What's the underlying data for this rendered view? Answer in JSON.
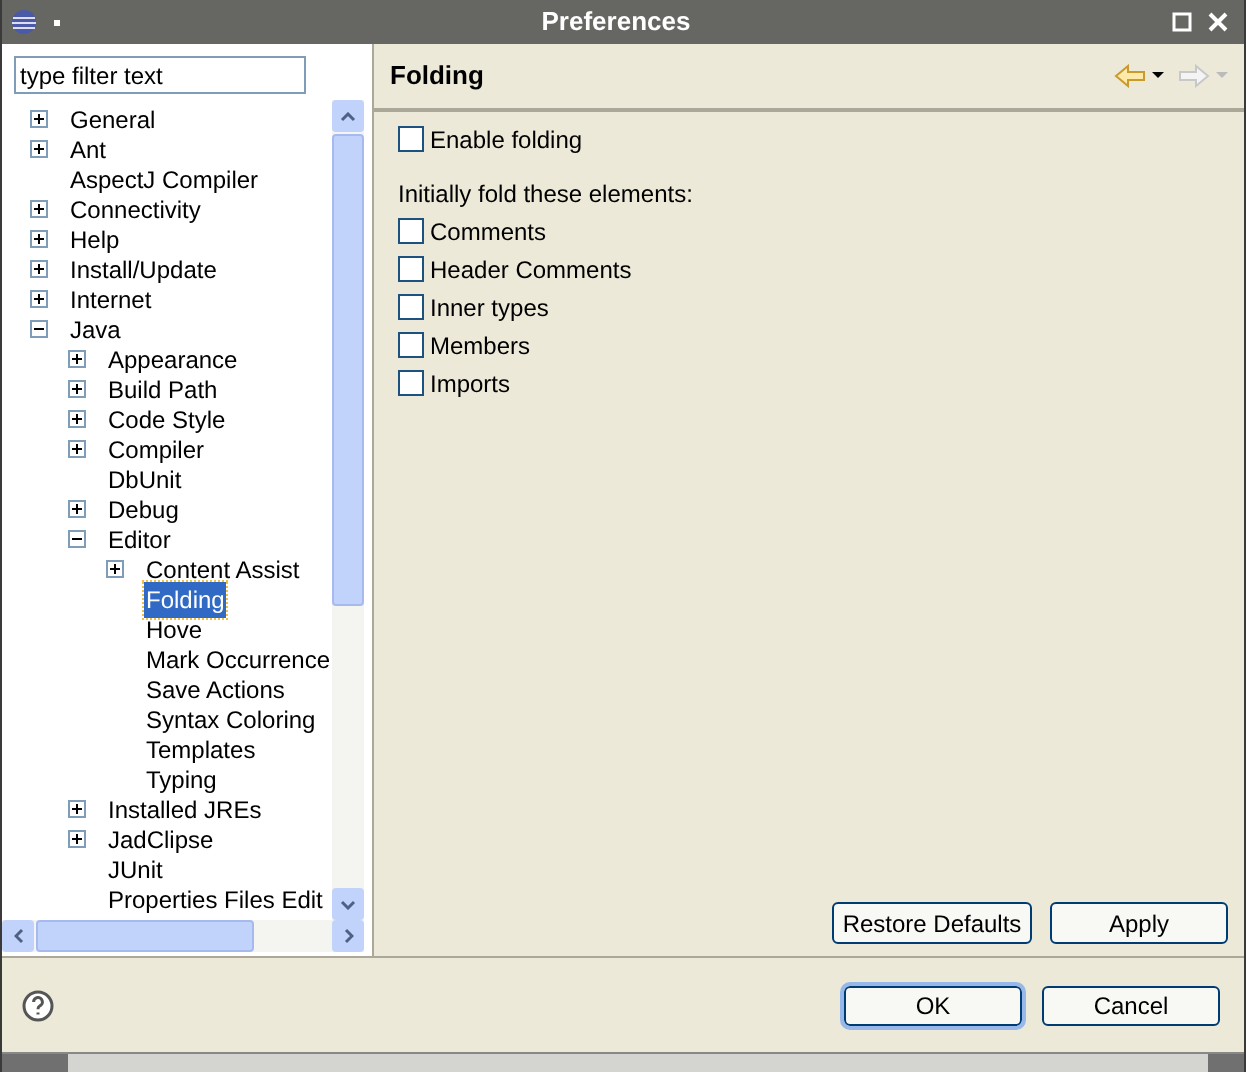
{
  "window": {
    "title": "Preferences"
  },
  "filter": {
    "placeholder": "type filter text"
  },
  "tree": [
    {
      "label": "General",
      "expanded": false,
      "selected": false
    },
    {
      "label": "Ant",
      "expanded": false,
      "selected": false
    },
    {
      "label": "AspectJ Compiler",
      "selected": false
    },
    {
      "label": "Connectivity",
      "expanded": false,
      "selected": false
    },
    {
      "label": "Help",
      "expanded": false,
      "selected": false
    },
    {
      "label": "Install/Update",
      "expanded": false,
      "selected": false
    },
    {
      "label": "Internet",
      "expanded": false,
      "selected": false
    },
    {
      "label": "Java",
      "expanded": true,
      "selected": false,
      "children": [
        {
          "label": "Appearance",
          "expanded": false,
          "selected": false
        },
        {
          "label": "Build Path",
          "expanded": false,
          "selected": false
        },
        {
          "label": "Code Style",
          "expanded": false,
          "selected": false
        },
        {
          "label": "Compiler",
          "expanded": false,
          "selected": false
        },
        {
          "label": "DbUnit",
          "selected": false
        },
        {
          "label": "Debug",
          "expanded": false,
          "selected": false
        },
        {
          "label": "Editor",
          "expanded": true,
          "selected": false,
          "children": [
            {
              "label": "Content Assist",
              "expanded": false,
              "selected": false
            },
            {
              "label": "Folding",
              "selected": true
            },
            {
              "label": "Hove",
              "selected": false
            },
            {
              "label": "Mark Occurrence",
              "selected": false
            },
            {
              "label": "Save Actions",
              "selected": false
            },
            {
              "label": "Syntax Coloring",
              "selected": false
            },
            {
              "label": "Templates",
              "selected": false
            },
            {
              "label": "Typing",
              "selected": false
            }
          ]
        },
        {
          "label": "Installed JREs",
          "expanded": false,
          "selected": false
        },
        {
          "label": "JadClipse",
          "expanded": false,
          "selected": false
        },
        {
          "label": "JUnit",
          "selected": false
        },
        {
          "label": "Properties Files Edit",
          "selected": false
        }
      ]
    }
  ],
  "page": {
    "title": "Folding",
    "enable": {
      "label": "Enable folding",
      "checked": false
    },
    "section_label": "Initially fold these elements:",
    "options": [
      {
        "label": "Comments",
        "checked": false
      },
      {
        "label": "Header Comments",
        "checked": false
      },
      {
        "label": "Inner types",
        "checked": false
      },
      {
        "label": "Members",
        "checked": false
      },
      {
        "label": "Imports",
        "checked": false
      }
    ]
  },
  "page_buttons": [
    "Restore Defaults",
    "Apply"
  ],
  "dialog_buttons": [
    "OK",
    "Cancel"
  ]
}
